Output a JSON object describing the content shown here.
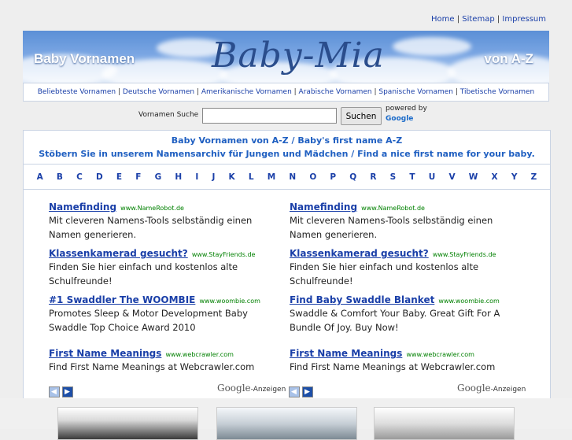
{
  "toplinks": [
    "Home",
    "Sitemap",
    "Impressum"
  ],
  "banner": {
    "left": "Baby Vornamen",
    "logo": "Baby-Mia",
    "right": "von A-Z"
  },
  "categories": [
    "Beliebteste Vornamen",
    "Deutsche Vornamen",
    "Amerikanische Vornamen",
    "Arabische Vornamen",
    "Spanische Vornamen",
    "Tibetische Vornamen"
  ],
  "search": {
    "label": "Vornamen Suche",
    "value": "",
    "button": "Suchen",
    "powered": "powered by",
    "google": "Google"
  },
  "headline": {
    "line1": "Baby Vornamen von A-Z / Baby's first name A-Z",
    "line2": "Stöbern Sie in unserem Namensarchiv für Jungen und Mädchen / Find a nice first name for your baby."
  },
  "alphabet": [
    "A",
    "B",
    "C",
    "D",
    "E",
    "F",
    "G",
    "H",
    "I",
    "J",
    "K",
    "L",
    "M",
    "N",
    "O",
    "P",
    "Q",
    "R",
    "S",
    "T",
    "U",
    "V",
    "W",
    "X",
    "Y",
    "Z"
  ],
  "ads_left": [
    {
      "title": "Namefinding",
      "url": "www.NameRobot.de",
      "desc": "Mit cleveren Namens-Tools selbständig einen Namen generieren."
    },
    {
      "title": "Klassenkamerad gesucht?",
      "url": "www.StayFriends.de",
      "desc": "Finden Sie hier einfach und kostenlos alte Schulfreunde!"
    },
    {
      "title": "#1 Swaddler The WOOMBIE",
      "url": "www.woombie.com",
      "desc": "Promotes Sleep & Motor Development Baby Swaddle Top Choice Award 2010"
    },
    {
      "title": "First Name Meanings",
      "url": "www.webcrawler.com",
      "desc": "Find First Name Meanings at Webcrawler.com"
    }
  ],
  "ads_right": [
    {
      "title": "Namefinding",
      "url": "www.NameRobot.de",
      "desc": "Mit cleveren Namens-Tools selbständig einen Namen generieren."
    },
    {
      "title": "Klassenkamerad gesucht?",
      "url": "www.StayFriends.de",
      "desc": "Finden Sie hier einfach und kostenlos alte Schulfreunde!"
    },
    {
      "title": "Find Baby Swaddle Blanket",
      "url": "www.woombie.com",
      "desc": "Swaddle & Comfort Your Baby. Great Gift For A Bundle Of Joy. Buy Now!"
    },
    {
      "title": "First Name Meanings",
      "url": "www.webcrawler.com",
      "desc": "Find First Name Meanings at Webcrawler.com"
    }
  ],
  "google_ads": {
    "brand": "Google",
    "suffix": "-Anzeigen"
  },
  "colors": {
    "accent": "#1a3fa8",
    "headline": "#1f5fc1",
    "url_green": "#008000"
  }
}
